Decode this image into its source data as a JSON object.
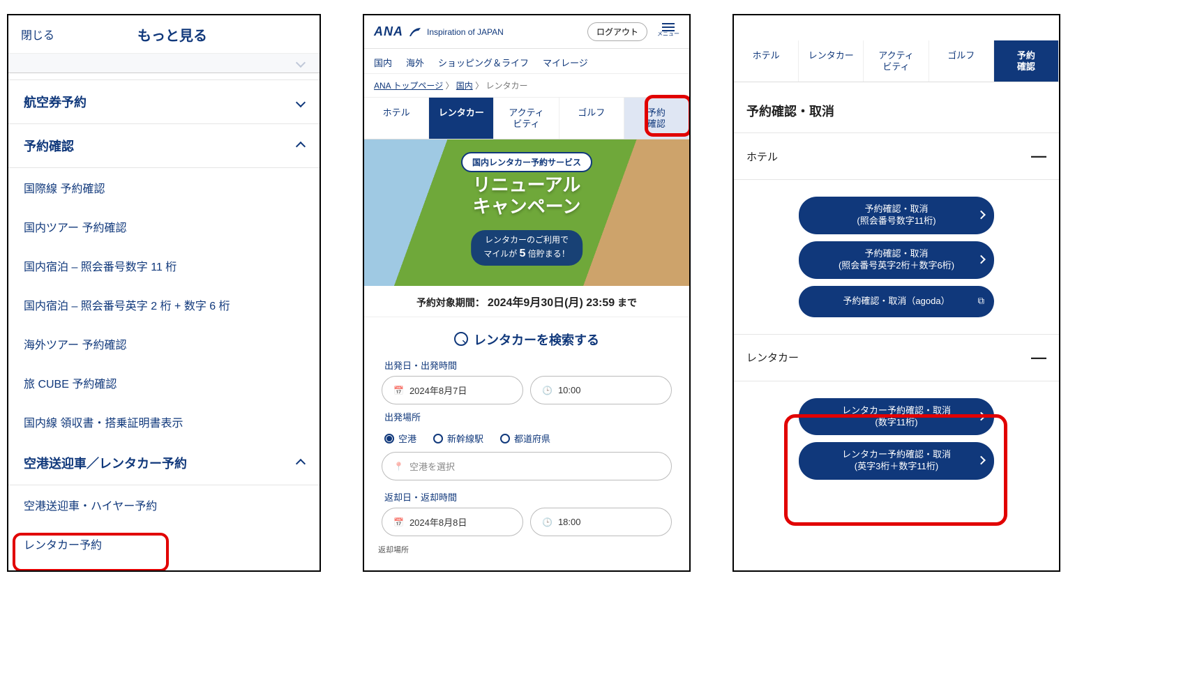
{
  "p1": {
    "close": "閉じる",
    "title": "もっと見る",
    "sections": {
      "flight": "航空券予約",
      "confirm": "予約確認",
      "airport": "空港送迎車／レンタカー予約"
    },
    "items": {
      "intl_confirm": "国際線 予約確認",
      "dom_tour_confirm": "国内ツアー 予約確認",
      "dom_stay_11": "国内宿泊 – 照会番号数字 11 桁",
      "dom_stay_26": "国内宿泊 – 照会番号英字 2 桁 + 数字 6 桁",
      "ovs_tour_confirm": "海外ツアー 予約確認",
      "tabi_cube": "旅 CUBE 予約確認",
      "dom_receipt": "国内線 領収書・搭乗証明書表示",
      "airport_hire": "空港送迎車・ハイヤー予約",
      "rentacar": "レンタカー予約"
    }
  },
  "p2": {
    "logo": "ANA",
    "tagline": "Inspiration of JAPAN",
    "logout": "ログアウト",
    "menu_label": "メニュー",
    "nav": {
      "dom": "国内",
      "intl": "海外",
      "shop": "ショッピング＆ライフ",
      "mile": "マイレージ"
    },
    "crumbs": {
      "a": "ANA トップページ",
      "b": "国内",
      "c": "レンタカー"
    },
    "tabs": {
      "hotel": "ホテル",
      "car": "レンタカー",
      "act1": "アクティ",
      "act2": "ビティ",
      "golf": "ゴルフ",
      "conf1": "予約",
      "conf2": "確認"
    },
    "hero": {
      "pill": "国内レンタカー予約サービス",
      "line1": "リニューアル",
      "line2": "キャンペーン",
      "sub1": "レンタカーのご利用で",
      "sub2a": "マイルが",
      "sub2b": "5",
      "sub2c": "倍貯まる！"
    },
    "period_a": "予約対象期間：",
    "period_b": "2024年9月30日(月) 23:59",
    "period_c": "まで",
    "search_title": "レンタカーを検索する",
    "labels": {
      "dep_dt": "出発日・出発時間",
      "dep_place": "出発場所",
      "ret_dt": "返却日・返却時間",
      "ret_place_tiny": "返却場所"
    },
    "fields": {
      "dep_date": "2024年8月7日",
      "dep_time": "10:00",
      "ret_date": "2024年8月8日",
      "ret_time": "18:00",
      "airport_ph": "空港を選択"
    },
    "radios": {
      "airport": "空港",
      "shinkansen": "新幹線駅",
      "pref": "都道府県"
    }
  },
  "p3": {
    "tabs": {
      "hotel": "ホテル",
      "car": "レンタカー",
      "act1": "アクティ",
      "act2": "ビティ",
      "golf": "ゴルフ",
      "conf1": "予約",
      "conf2": "確認"
    },
    "title": "予約確認・取消",
    "sec_hotel": "ホテル",
    "sec_car": "レンタカー",
    "pills": {
      "h1a": "予約確認・取消",
      "h1b": "(照会番号数字11桁)",
      "h2a": "予約確認・取消",
      "h2b": "(照会番号英字2桁＋数字6桁)",
      "h3": "予約確認・取消（agoda）",
      "c1a": "レンタカー予約確認・取消",
      "c1b": "(数字11桁)",
      "c2a": "レンタカー予約確認・取消",
      "c2b": "(英字3桁＋数字11桁)"
    }
  }
}
